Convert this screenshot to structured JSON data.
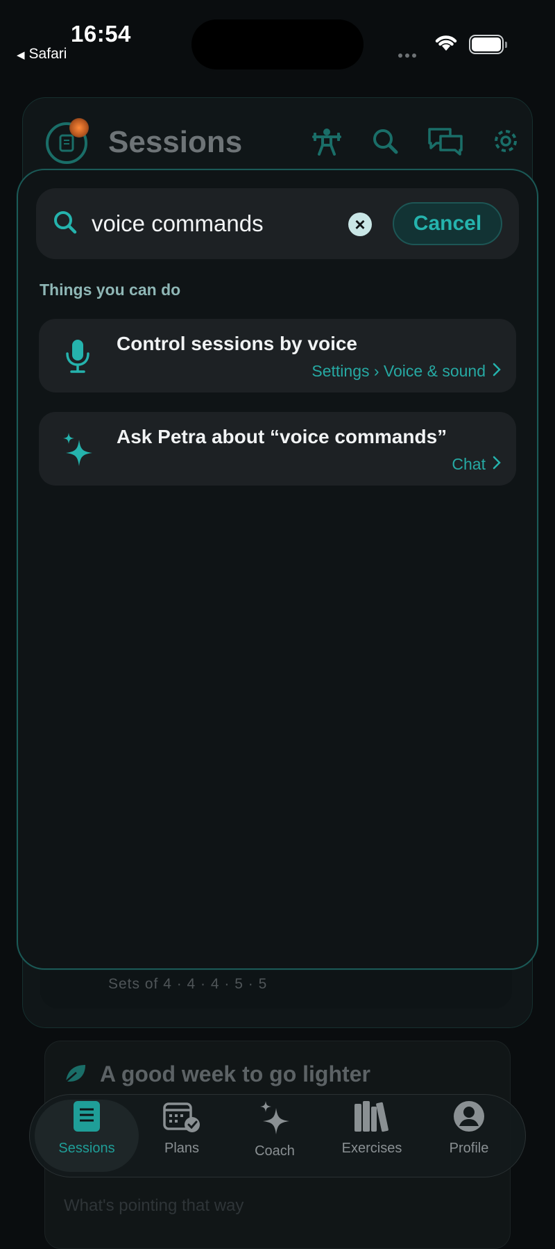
{
  "status_bar": {
    "time": "16:54",
    "back_label": "Safari"
  },
  "background": {
    "title": "Sessions",
    "header_icons": [
      "weightlifter-icon",
      "search-icon",
      "chat-bubbles-icon",
      "gear-icon"
    ],
    "sets_text": "Sets of 4 · 4 · 4 · 5 · 5",
    "card2_title": "A good week to go lighter",
    "card2_line": "What's pointing that way"
  },
  "search": {
    "query": "voice commands",
    "cancel_label": "Cancel",
    "section_label": "Things you can do"
  },
  "results": [
    {
      "icon": "microphone-icon",
      "title": "Control sessions by voice",
      "path": "Settings › Voice & sound"
    },
    {
      "icon": "sparkle-icon",
      "title": "Ask Petra about “voice commands”",
      "path": "Chat"
    }
  ],
  "tabs": [
    {
      "label": "Sessions",
      "icon": "notebook-icon",
      "active": true
    },
    {
      "label": "Plans",
      "icon": "calendar-check-icon",
      "active": false
    },
    {
      "label": "Coach",
      "icon": "sparkle-icon",
      "active": false
    },
    {
      "label": "Exercises",
      "icon": "books-icon",
      "active": false
    },
    {
      "label": "Profile",
      "icon": "person-icon",
      "active": false
    }
  ],
  "colors": {
    "accent": "#25b3ad",
    "background": "#0a0d0f",
    "sheet": "#0f1416",
    "card": "#1d2124"
  }
}
